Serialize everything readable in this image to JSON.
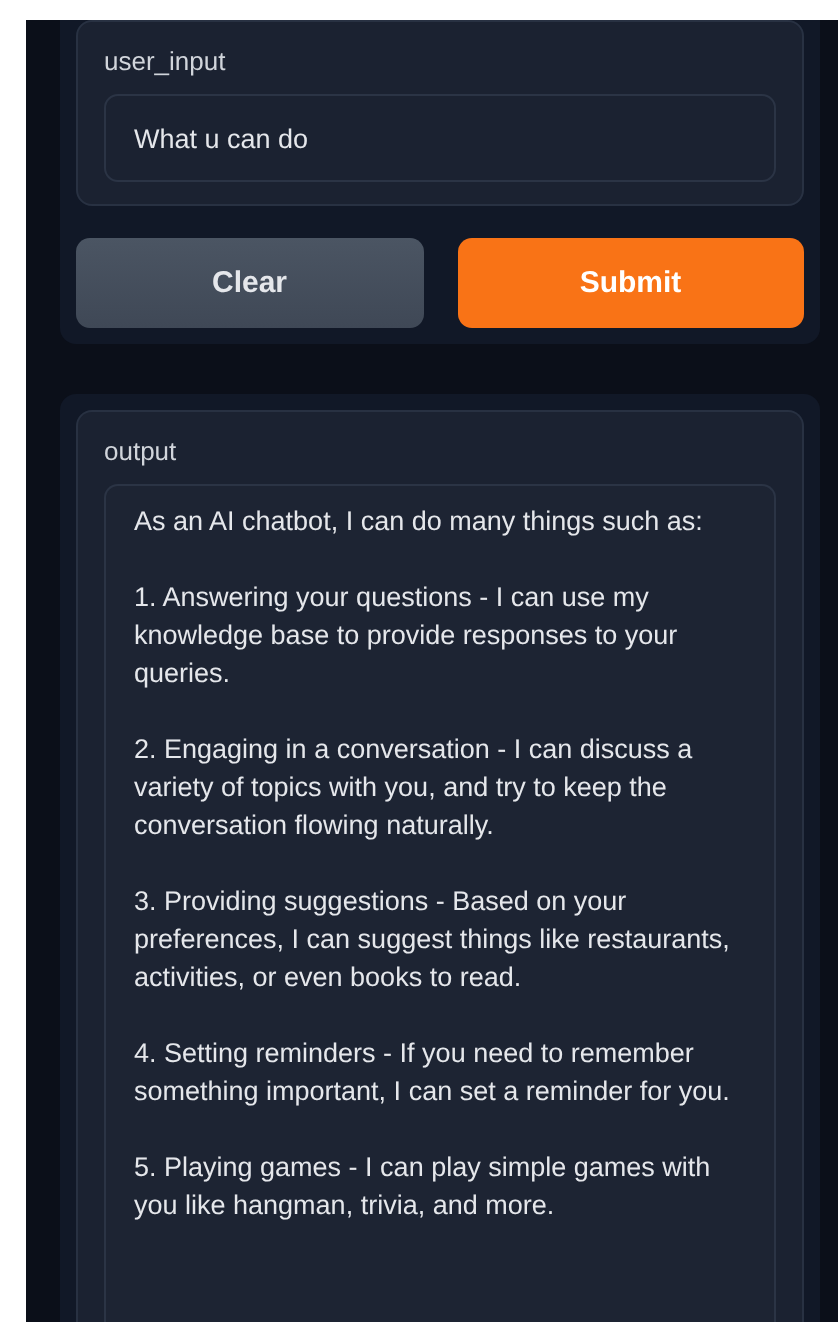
{
  "input_panel": {
    "label": "user_input",
    "value": "What u can do"
  },
  "buttons": [
    {
      "label": "Clear",
      "kind": "secondary"
    },
    {
      "label": "Submit",
      "kind": "primary"
    }
  ],
  "output_panel": {
    "label": "output",
    "paragraphs": [
      "As an AI chatbot, I can do many things such as:",
      "1. Answering your questions - I can use my knowledge base to provide responses to your queries.",
      "2. Engaging in a conversation - I can discuss a variety of topics with you, and try to keep the conversation flowing naturally.",
      "3. Providing suggestions - Based on your preferences, I can suggest things like restaurants, activities, or even books to read.",
      "4. Setting reminders - If you need to remember something important, I can set a reminder for you.",
      "5. Playing games - I can play simple games with you like hangman, trivia, and more."
    ]
  }
}
